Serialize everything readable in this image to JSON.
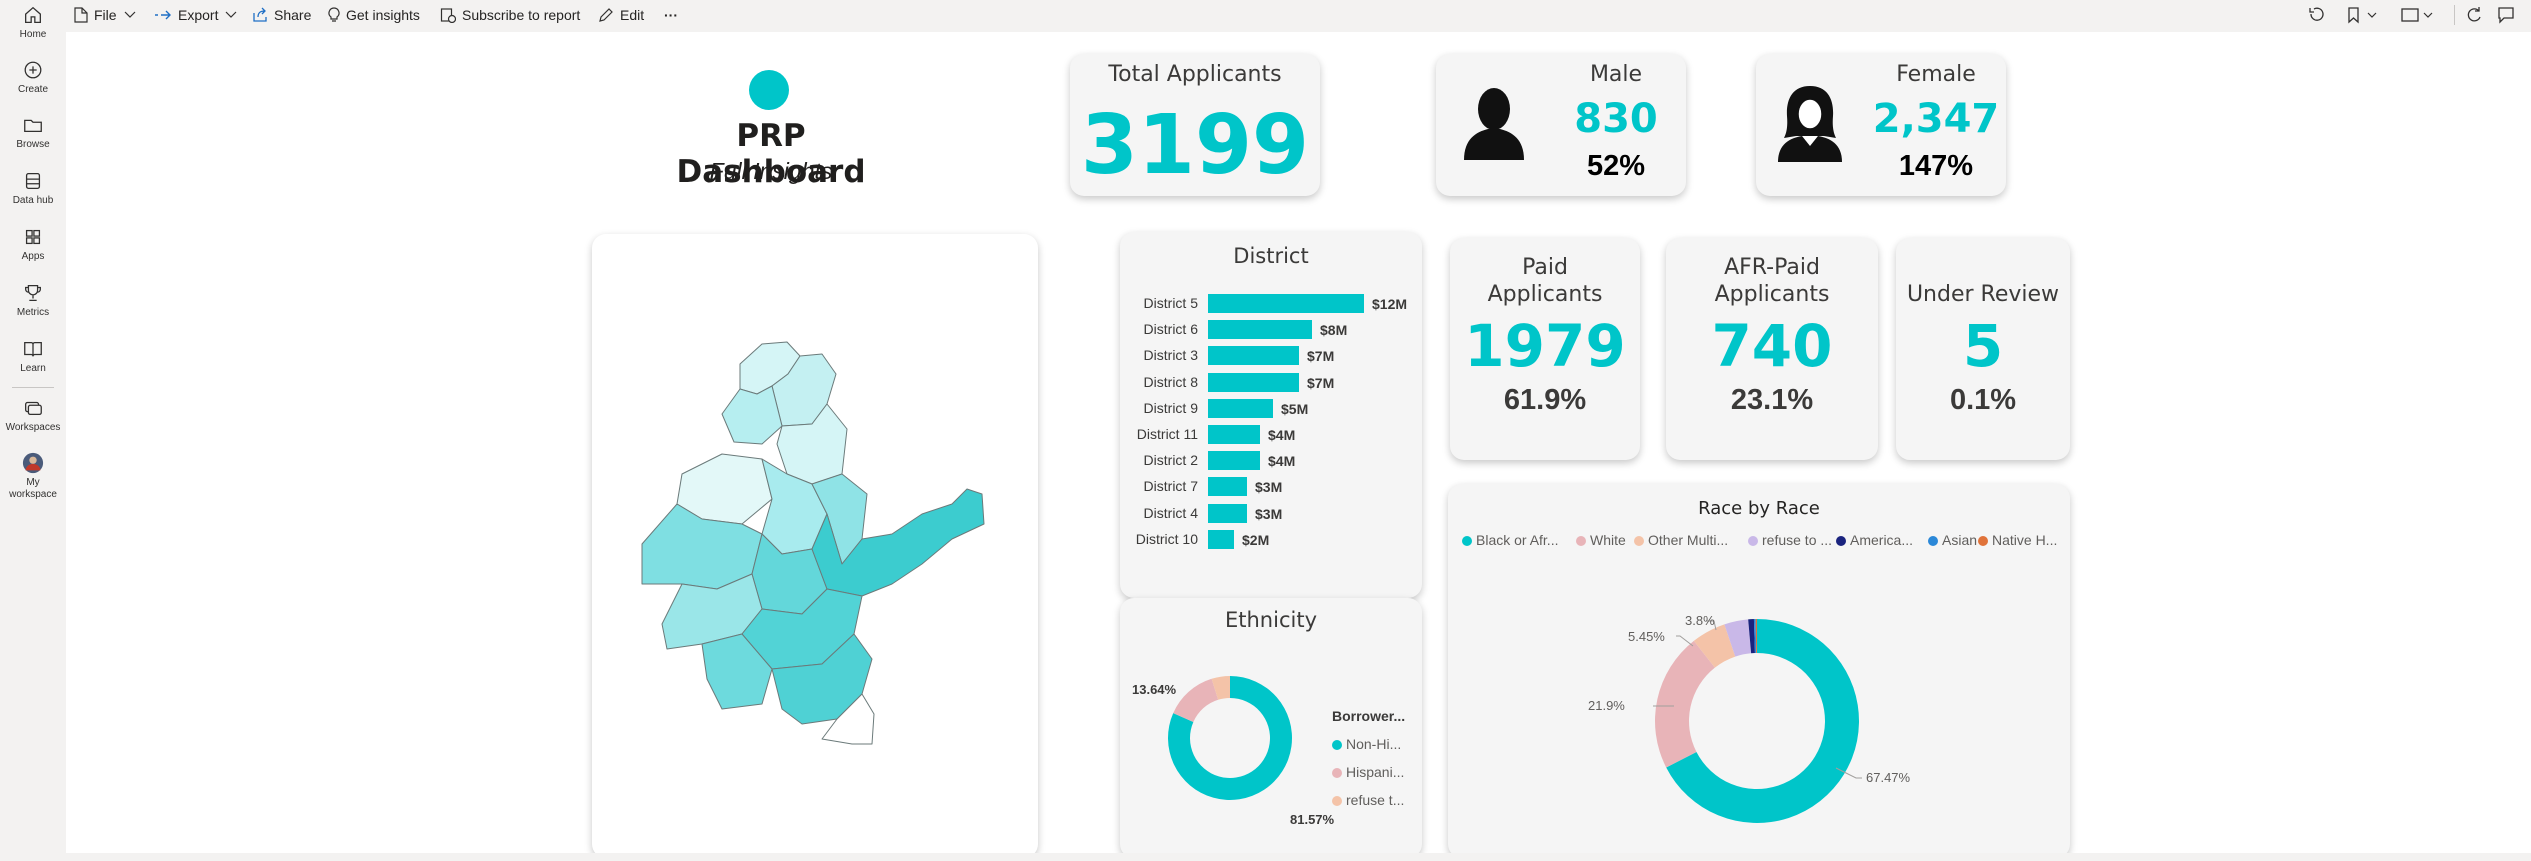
{
  "nav": [
    {
      "id": "home",
      "label": "Home",
      "icon": "home-icon"
    },
    {
      "id": "create",
      "label": "Create",
      "icon": "plus-circle-icon"
    },
    {
      "id": "browse",
      "label": "Browse",
      "icon": "folder-icon"
    },
    {
      "id": "datahub",
      "label": "Data hub",
      "icon": "database-icon"
    },
    {
      "id": "apps",
      "label": "Apps",
      "icon": "apps-icon"
    },
    {
      "id": "metrics",
      "label": "Metrics",
      "icon": "trophy-icon"
    },
    {
      "id": "learn",
      "label": "Learn",
      "icon": "book-icon"
    },
    {
      "id": "workspaces",
      "label": "Workspaces",
      "icon": "workspaces-icon"
    },
    {
      "id": "myworkspace",
      "label_line1": "My",
      "label_line2": "workspace",
      "icon": "avatar"
    }
  ],
  "toolbar": {
    "file": "File",
    "export": "Export",
    "share": "Share",
    "insights": "Get insights",
    "subscribe": "Subscribe to report",
    "edit": "Edit",
    "more": "···"
  },
  "header": {
    "title": "PRP Dashboard",
    "subtitle": "Full Insights"
  },
  "kpis": {
    "total": {
      "title": "Total Applicants",
      "value": "3199"
    },
    "male": {
      "title": "Male",
      "value": "830",
      "pct": "52%"
    },
    "female": {
      "title": "Female",
      "value": "2,347",
      "pct": "147%"
    },
    "paid": {
      "title_line1": "Paid",
      "title_line2": "Applicants",
      "value": "1979",
      "pct": "61.9%"
    },
    "afr": {
      "title_line1": "AFR-Paid",
      "title_line2": "Applicants",
      "value": "740",
      "pct": "23.1%"
    },
    "review": {
      "title": "Under Review",
      "value": "5",
      "pct": "0.1%"
    }
  },
  "colors": {
    "teal": "#00c5c9",
    "pink": "#e8b4b8",
    "peach": "#f4c3a8",
    "lavender": "#c9b8e8",
    "navy": "#1a237e",
    "blue": "#2b88d8",
    "orange": "#e0733a"
  },
  "chart_data": [
    {
      "type": "bar",
      "title": "District",
      "orientation": "horizontal",
      "categories": [
        "District 5",
        "District 6",
        "District 3",
        "District 8",
        "District 9",
        "District 11",
        "District 2",
        "District 7",
        "District 4",
        "District 10"
      ],
      "values": [
        12,
        8,
        7,
        7,
        5,
        4,
        4,
        3,
        3,
        2
      ],
      "value_labels": [
        "$12M",
        "$8M",
        "$7M",
        "$7M",
        "$5M",
        "$4M",
        "$4M",
        "$3M",
        "$3M",
        "$2M"
      ],
      "color": "#00c5c9"
    },
    {
      "type": "pie",
      "title": "Ethnicity",
      "legend_title": "Borrower...",
      "legend": [
        "Non-Hi...",
        "Hispani...",
        "refuse t..."
      ],
      "values": [
        81.57,
        13.64,
        4.79
      ],
      "labels": [
        "81.57%",
        "13.64%",
        ""
      ],
      "colors": [
        "#00c5c9",
        "#e8b4b8",
        "#f4c3a8"
      ]
    },
    {
      "type": "pie",
      "title": "Race by Race",
      "legend": [
        "Black or Afr...",
        "White",
        "Other Multi...",
        "refuse to ...",
        "America...",
        "Asian",
        "Native H..."
      ],
      "values": [
        67.47,
        21.9,
        5.45,
        3.8,
        0.9,
        0.28,
        0.2
      ],
      "labels": [
        "67.47%",
        "21.9%",
        "5.45%",
        "3.8%",
        "",
        "",
        ""
      ],
      "colors": [
        "#00c5c9",
        "#e8b4b8",
        "#f4c3a8",
        "#c9b8e8",
        "#1a237e",
        "#2b88d8",
        "#e0733a"
      ]
    }
  ]
}
